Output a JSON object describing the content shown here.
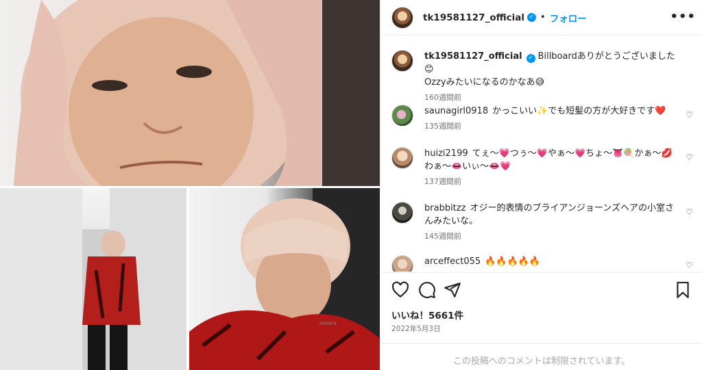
{
  "post": {
    "username": "tk19581127_official",
    "follow_label": "フォロー",
    "separator": "•",
    "more_label": "•••"
  },
  "caption": {
    "username": "tk19581127_official",
    "text_line1": "Billboardありがとうございました😊",
    "text_line2": "Ozzyみたいになるのかなあ😅",
    "time": "160週間前"
  },
  "comments": [
    {
      "username": "saunagirl0918",
      "text": "かっこいい✨でも短髪の方が大好きです❤️",
      "time": "135週間前"
    },
    {
      "username": "huizi2199",
      "text": "てぇ〜💗つぅ〜💗やぁ〜💗ちょ〜👅🍭かぁ〜💋",
      "text2": "わぁ〜👄いぃ〜👄💗",
      "time": "137週間前"
    },
    {
      "username": "brabbitzz",
      "text": "オジー的表情のブライアンジョーンズヘアの小室さ",
      "text2": "んみたいな。",
      "time": "145週間前"
    },
    {
      "username": "arceffect055",
      "text": "🔥🔥🔥🔥🔥"
    }
  ],
  "actions": {
    "likes": "いいね！5661件",
    "date": "2022年5月3日"
  },
  "footer": {
    "limited_text": "この投稿へのコメントは制限されています。"
  },
  "icons": {
    "verified": "verified-badge-icon",
    "like": "heart-outline-icon",
    "comment": "comment-bubble-icon",
    "share": "send-paper-plane-icon",
    "save": "bookmark-icon",
    "more": "more-options-icon"
  },
  "colors": {
    "link_blue": "#0095f6",
    "text": "#262626",
    "muted": "#737373",
    "divider": "#efefef"
  }
}
